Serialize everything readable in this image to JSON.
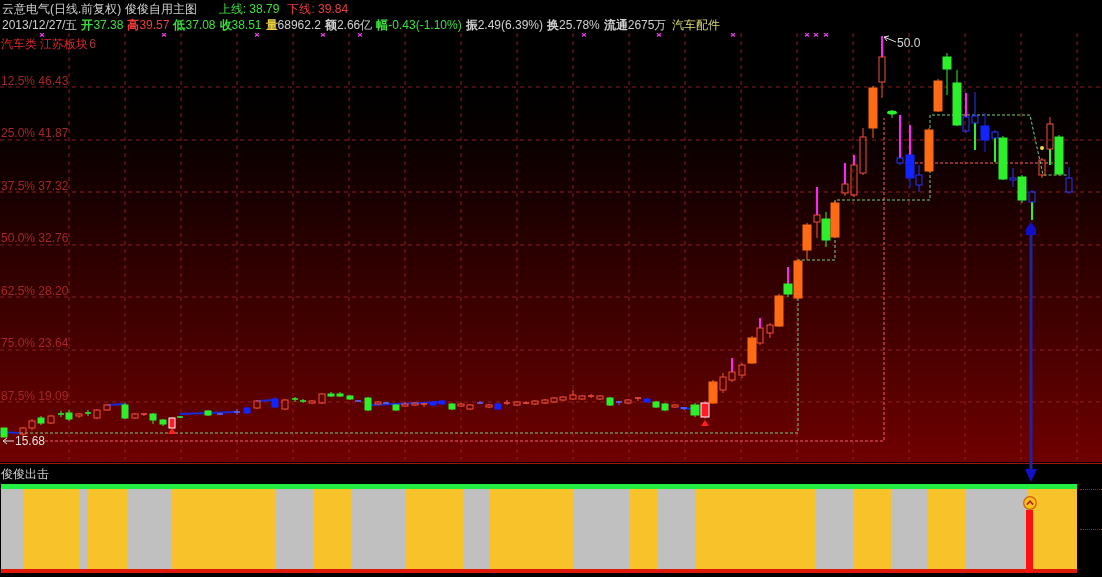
{
  "header": {
    "title": "云意电气(日线.前复权) 俊俊自用主图",
    "lines": [
      {
        "text": "上线: 38.79",
        "color": "#3ce03c"
      },
      {
        "text": "下线: 39.84",
        "color": "#f03c3c"
      }
    ]
  },
  "quote": {
    "date": "2013/12/27/五",
    "fields": [
      {
        "label": {
          "text": "开",
          "color": "#3ce03c"
        },
        "value": {
          "text": "37.38",
          "color": "#3ce03c"
        }
      },
      {
        "label": {
          "text": "高",
          "color": "#f03c3c"
        },
        "value": {
          "text": "39.57",
          "color": "#f03c3c"
        }
      },
      {
        "label": {
          "text": "低",
          "color": "#3ce03c"
        },
        "value": {
          "text": "37.08",
          "color": "#3ce03c"
        }
      },
      {
        "label": {
          "text": "收",
          "color": "#3ce03c"
        },
        "value": {
          "text": "38.51",
          "color": "#3ce03c"
        }
      },
      {
        "label": {
          "text": "量",
          "color": "#e8d040"
        },
        "value": {
          "text": "68962.2",
          "color": "#d0d0d0"
        }
      },
      {
        "label": {
          "text": "额",
          "color": "#d0d0d0"
        },
        "value": {
          "text": "2.66亿",
          "color": "#d0d0d0"
        }
      },
      {
        "label": {
          "text": "幅",
          "color": "#3ce03c"
        },
        "value": {
          "text": "-0.43(-1.10%)",
          "color": "#3ce03c"
        }
      },
      {
        "label": {
          "text": "振",
          "color": "#d0d0d0"
        },
        "value": {
          "text": "2.49(6.39%)",
          "color": "#d0d0d0"
        }
      },
      {
        "label": {
          "text": "换",
          "color": "#d0d0d0"
        },
        "value": {
          "text": "25.78%",
          "color": "#d0d0d0"
        }
      },
      {
        "label": {
          "text": "流通",
          "color": "#d0d0d0"
        },
        "value": {
          "text": "2675万",
          "color": "#d0d0d0"
        }
      }
    ],
    "sector": "汽车配件"
  },
  "chart": {
    "board": "汽车类 江苏板块",
    "board_extra": "6",
    "levels": [
      "12.5% 46.43",
      "25.0% 41.87",
      "37.5% 37.32",
      "50.0% 32.76",
      "62.5% 28.20",
      "75.0% 23.64",
      "87.5% 19.09"
    ],
    "high": "50.0",
    "low": "15.68"
  },
  "indicator": {
    "title": "俊俊出击"
  }
}
